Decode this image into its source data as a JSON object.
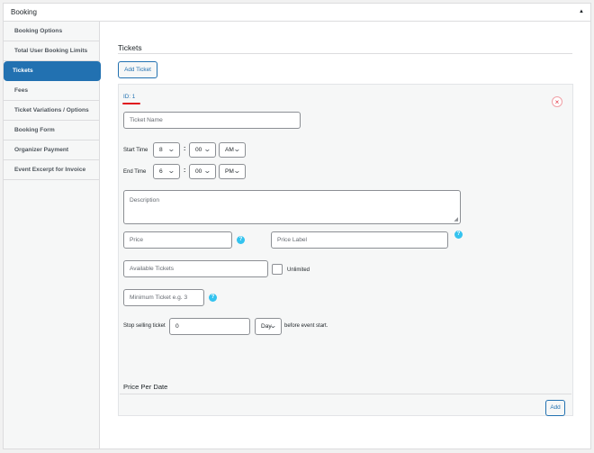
{
  "panel": {
    "title": "Booking",
    "collapse_icon": "triangle-up-icon"
  },
  "sidebar": {
    "items": [
      {
        "label": "Booking Options",
        "active": false
      },
      {
        "label": "Total User Booking Limits",
        "active": false
      },
      {
        "label": "Tickets",
        "active": true
      },
      {
        "label": "Fees",
        "active": false
      },
      {
        "label": "Ticket Variations / Options",
        "active": false
      },
      {
        "label": "Booking Form",
        "active": false
      },
      {
        "label": "Organizer Payment",
        "active": false
      },
      {
        "label": "Event Excerpt for Invoice",
        "active": false
      }
    ]
  },
  "main": {
    "section_title": "Tickets",
    "add_ticket_label": "Add Ticket"
  },
  "ticket": {
    "id_label": "ID: 1",
    "remove_icon": "×",
    "name_placeholder": "Ticket Name",
    "start_time": {
      "label": "Start Time",
      "hour": "8",
      "minute": "00",
      "ampm": "AM"
    },
    "end_time": {
      "label": "End Time",
      "hour": "6",
      "minute": "00",
      "ampm": "PM"
    },
    "description_placeholder": "Description",
    "price_placeholder": "Price",
    "price_label_placeholder": "Price Label",
    "available_tickets_placeholder": "Available Tickets",
    "unlimited_label": "Unlimited",
    "unlimited_checked": false,
    "minimum_ticket_placeholder": "Minimum Ticket e.g. 3",
    "stop_selling": {
      "label": "Stop selling ticket",
      "value": "0",
      "unit": "Day",
      "suffix": "before event start."
    },
    "help_glyph": "?",
    "price_per_date_title": "Price Per Date",
    "add_label": "Add"
  },
  "colors": {
    "accent": "#2271b1",
    "help": "#34c3ef",
    "remove": "#e02b3c",
    "marker": "#e0141e"
  }
}
